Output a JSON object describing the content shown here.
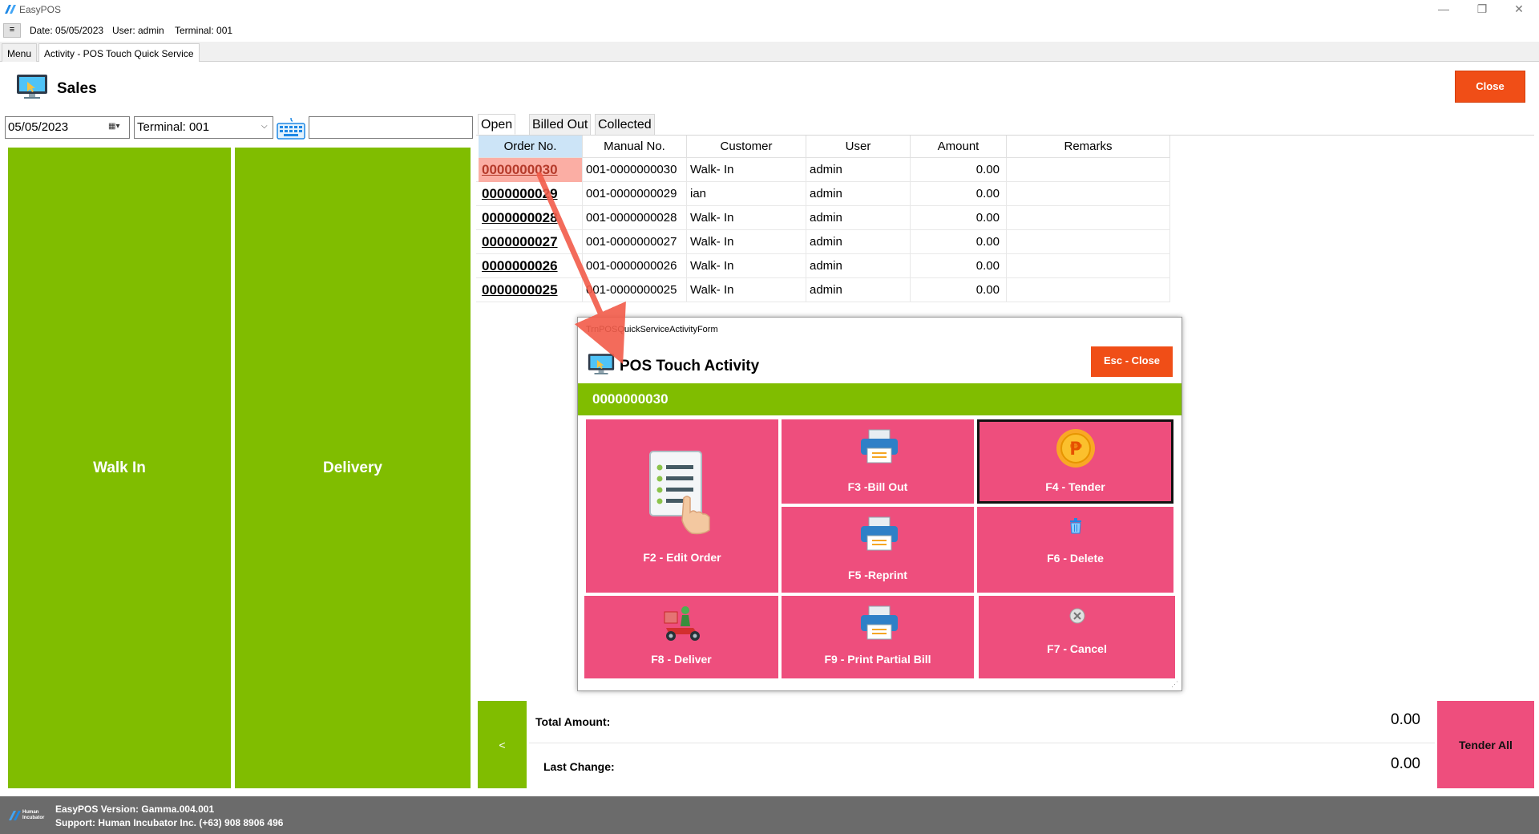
{
  "window": {
    "title": "EasyPOS",
    "controls": {
      "minimize": "—",
      "maximize": "❐",
      "close": "✕"
    }
  },
  "infobar": {
    "toggle_label": "≡",
    "date": "Date: 05/05/2023",
    "user": "User: admin",
    "terminal": "Terminal: 001"
  },
  "tabs": [
    {
      "label": "Menu"
    },
    {
      "label": "Activity - POS Touch Quick Service"
    }
  ],
  "header": {
    "title": "Sales",
    "close_label": "Close"
  },
  "filters": {
    "date": "05/05/2023",
    "terminal": "Terminal: 001",
    "search": ""
  },
  "left_buttons": {
    "walk_in": "Walk In",
    "delivery": "Delivery"
  },
  "subtabs": [
    {
      "label": "Open"
    },
    {
      "label": "Billed Out"
    },
    {
      "label": "Collected"
    }
  ],
  "grid": {
    "columns": [
      "Order No.",
      "Manual No.",
      "Customer",
      "User",
      "Amount",
      "Remarks"
    ],
    "rows": [
      [
        "0000000030",
        "001-0000000030",
        "Walk- In",
        "admin",
        "0.00",
        ""
      ],
      [
        "0000000029",
        "001-0000000029",
        "ian",
        "admin",
        "0.00",
        ""
      ],
      [
        "0000000028",
        "001-0000000028",
        "Walk- In",
        "admin",
        "0.00",
        ""
      ],
      [
        "0000000027",
        "001-0000000027",
        "Walk- In",
        "admin",
        "0.00",
        ""
      ],
      [
        "0000000026",
        "001-0000000026",
        "Walk- In",
        "admin",
        "0.00",
        ""
      ],
      [
        "0000000025",
        "001-0000000025",
        "Walk- In",
        "admin",
        "0.00",
        ""
      ]
    ]
  },
  "totals": {
    "back_label": "<",
    "total_amount_label": "Total Amount:",
    "total_amount": "0.00",
    "last_change_label": "Last Change:",
    "last_change": "0.00",
    "tender_all_label": "Tender All"
  },
  "footer": {
    "version": "EasyPOS Version: Gamma.004.001",
    "support": "Support: Human Incubator Inc. (+63) 908 8906 496",
    "logo_text": "Human Incubator"
  },
  "modal": {
    "caption": "TrnPOSQuickServiceActivityForm",
    "title": "POS Touch Activity",
    "esc_label": "Esc - Close",
    "order_no": "0000000030",
    "actions": {
      "edit_order": "F2 - Edit Order",
      "bill_out": "F3 -Bill Out",
      "tender": "F4 - Tender",
      "reprint": "F5 -Reprint",
      "delete": "F6 - Delete",
      "deliver": "F8 - Deliver",
      "print_partial": "F9 - Print Partial Bill",
      "cancel": "F7 - Cancel"
    }
  },
  "colors": {
    "green": "#80bd00",
    "orange": "#f04e17",
    "pink": "#ee4e7d",
    "selected_row": "#fbaea4",
    "header_selected": "#cce4f7",
    "footer": "#6b6b6b"
  }
}
